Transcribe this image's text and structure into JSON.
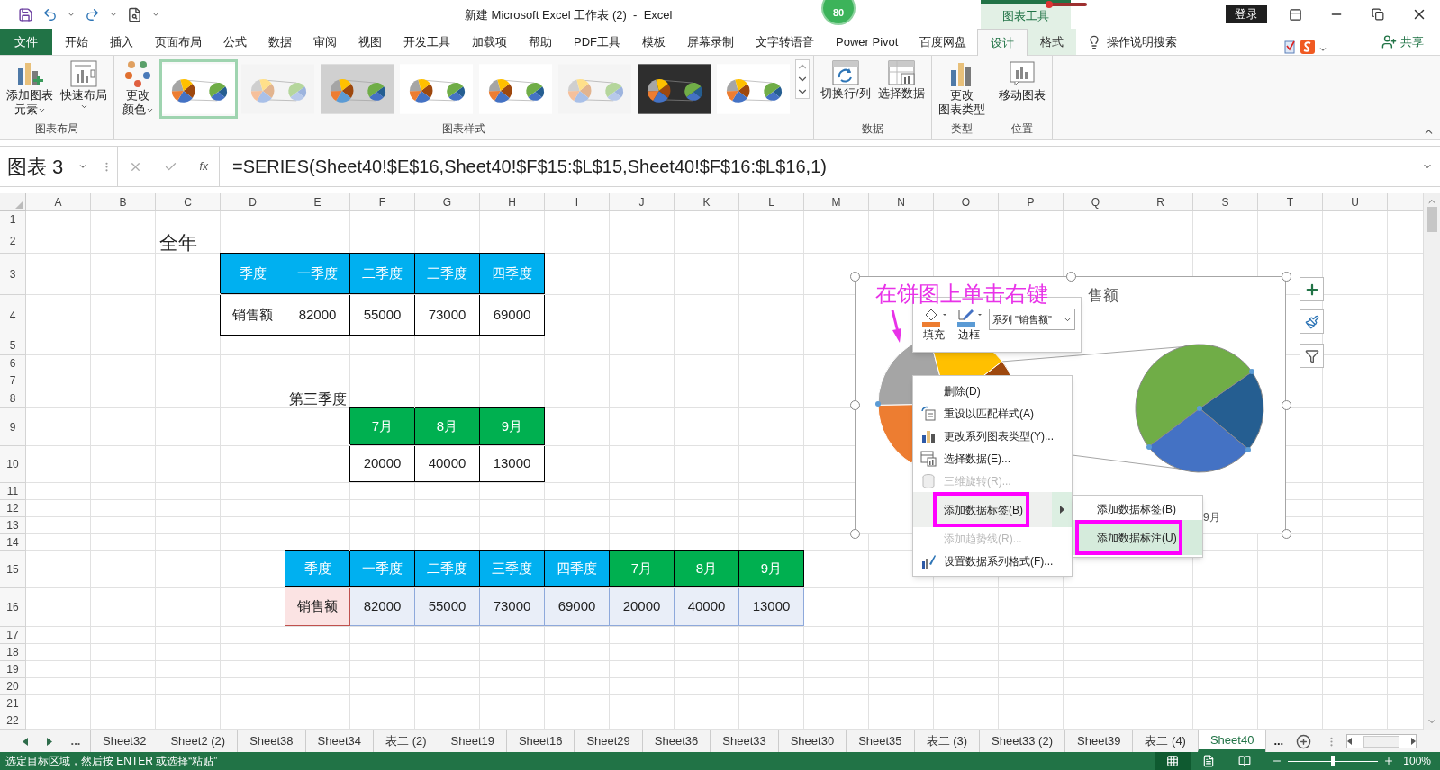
{
  "title_bar": {
    "title": "新建 Microsoft Excel 工作表 (2)  -  Excel",
    "badge": "80",
    "context_group": "图表工具",
    "login": "登录"
  },
  "ribbon_tabs": [
    {
      "label": "文件",
      "kind": "file",
      "selected": false
    },
    {
      "label": "开始",
      "kind": "plain",
      "selected": false
    },
    {
      "label": "插入",
      "kind": "plain",
      "selected": false
    },
    {
      "label": "页面布局",
      "kind": "plain",
      "selected": false
    },
    {
      "label": "公式",
      "kind": "plain",
      "selected": false
    },
    {
      "label": "数据",
      "kind": "plain",
      "selected": false
    },
    {
      "label": "审阅",
      "kind": "plain",
      "selected": false
    },
    {
      "label": "视图",
      "kind": "plain",
      "selected": false
    },
    {
      "label": "开发工具",
      "kind": "plain",
      "selected": false
    },
    {
      "label": "加载项",
      "kind": "plain",
      "selected": false
    },
    {
      "label": "帮助",
      "kind": "plain",
      "selected": false
    },
    {
      "label": "PDF工具",
      "kind": "plain",
      "selected": false
    },
    {
      "label": "模板",
      "kind": "plain",
      "selected": false
    },
    {
      "label": "屏幕录制",
      "kind": "plain",
      "selected": false
    },
    {
      "label": "文字转语音",
      "kind": "plain",
      "selected": false
    },
    {
      "label": "Power Pivot",
      "kind": "plain",
      "selected": false
    },
    {
      "label": "百度网盘",
      "kind": "plain",
      "selected": false
    },
    {
      "label": "设计",
      "kind": "context",
      "selected": true
    },
    {
      "label": "格式",
      "kind": "context",
      "selected": false
    }
  ],
  "tell_me": "操作说明搜索",
  "share": "共享",
  "ribbon_groups": [
    {
      "name": "图表布局",
      "buttons": [
        {
          "lines": [
            "添加图表",
            "元素"
          ],
          "kind": "add-element",
          "dropdown": true
        },
        {
          "lines": [
            "快速布局"
          ],
          "kind": "layout",
          "dropdown": true
        }
      ]
    },
    {
      "name": "图表样式",
      "color_button": {
        "lines": [
          "更改",
          "颜色"
        ],
        "dropdown": true
      },
      "styles": [
        {
          "kind": "light",
          "selected": true
        },
        {
          "kind": "hatched",
          "selected": false
        },
        {
          "kind": "gray",
          "selected": false
        },
        {
          "kind": "light",
          "selected": false
        },
        {
          "kind": "light",
          "selected": false
        },
        {
          "kind": "hatched",
          "selected": false
        },
        {
          "kind": "dark",
          "selected": false
        },
        {
          "kind": "light",
          "selected": false
        }
      ]
    },
    {
      "name": "数据",
      "buttons": [
        {
          "lines": [
            "切换行/列"
          ],
          "kind": "switch",
          "dropdown": false
        },
        {
          "lines": [
            "选择数据"
          ],
          "kind": "select-data",
          "dropdown": false
        }
      ]
    },
    {
      "name": "类型",
      "buttons": [
        {
          "lines": [
            "更改",
            "图表类型"
          ],
          "kind": "change-type",
          "dropdown": false
        }
      ]
    },
    {
      "name": "位置",
      "buttons": [
        {
          "lines": [
            "移动图表"
          ],
          "kind": "move",
          "dropdown": false
        }
      ]
    }
  ],
  "formula_bar": {
    "name_box": "图表 3",
    "function_button": "fx",
    "formula": "=SERIES(Sheet40!$E$16,Sheet40!$F$15:$L$15,Sheet40!$F$16:$L$16,1)"
  },
  "sheet": {
    "columns": [
      "A",
      "B",
      "C",
      "D",
      "E",
      "F",
      "G",
      "H",
      "I",
      "J",
      "K",
      "L",
      "M",
      "N",
      "O",
      "P",
      "Q",
      "R",
      "S",
      "T",
      "U"
    ],
    "rows": [
      "1",
      "2",
      "3",
      "4",
      "5",
      "6",
      "7",
      "8",
      "9",
      "10",
      "11",
      "12",
      "13",
      "14",
      "15",
      "16",
      "17",
      "18",
      "19",
      "20",
      "21",
      "22"
    ],
    "labels": [
      {
        "text": "全年",
        "kind": "heading"
      },
      {
        "text": "第三季度",
        "kind": "label"
      }
    ],
    "tables": [
      {
        "kind": "plain",
        "rows": [
          [
            {
              "text": "季度",
              "color": "#00b0f0"
            },
            {
              "text": "一季度",
              "color": "#00b0f0"
            },
            {
              "text": "二季度",
              "color": "#00b0f0"
            },
            {
              "text": "三季度",
              "color": "#00b0f0"
            },
            {
              "text": "四季度",
              "color": "#00b0f0"
            }
          ],
          [
            {
              "text": "销售额"
            },
            {
              "text": "82000"
            },
            {
              "text": "55000"
            },
            {
              "text": "73000"
            },
            {
              "text": "69000"
            }
          ]
        ]
      },
      {
        "kind": "plain",
        "rows": [
          [
            {
              "text": "7月",
              "color": "#00b050"
            },
            {
              "text": "8月",
              "color": "#00b050"
            },
            {
              "text": "9月",
              "color": "#00b050"
            }
          ],
          [
            {
              "text": "20000"
            },
            {
              "text": "40000"
            },
            {
              "text": "13000"
            }
          ]
        ]
      },
      {
        "kind": "chart-source",
        "rows": [
          [
            {
              "text": "季度",
              "color": "#00b0f0"
            },
            {
              "text": "一季度",
              "color": "#00b0f0"
            },
            {
              "text": "二季度",
              "color": "#00b0f0"
            },
            {
              "text": "三季度",
              "color": "#00b0f0"
            },
            {
              "text": "四季度",
              "color": "#00b0f0"
            },
            {
              "text": "7月",
              "color": "#00b050"
            },
            {
              "text": "8月",
              "color": "#00b050"
            },
            {
              "text": "9月",
              "color": "#00b050"
            }
          ],
          [
            {
              "text": "销售额"
            },
            {
              "text": "82000"
            },
            {
              "text": "55000"
            },
            {
              "text": "73000"
            },
            {
              "text": "69000"
            },
            {
              "text": "20000"
            },
            {
              "text": "40000"
            },
            {
              "text": "13000"
            }
          ]
        ]
      }
    ]
  },
  "chart": {
    "kind": "pie-of-pie",
    "title": "售额",
    "legend_item": "9月",
    "annotation": "在饼图上单击右键"
  },
  "mini_toolbar": {
    "fill": "填充",
    "border": "边框",
    "series": "系列 \"销售额\""
  },
  "context_menu": [
    {
      "label": "删除(D)",
      "kind": "none",
      "submenu": false,
      "disabled": false,
      "selected": false,
      "annotated": false
    },
    {
      "label": "重设以匹配样式(A)",
      "kind": "reset",
      "submenu": false,
      "disabled": false,
      "selected": false,
      "annotated": false
    },
    {
      "label": "更改系列图表类型(Y)...",
      "kind": "chart",
      "submenu": false,
      "disabled": false,
      "selected": false,
      "annotated": false
    },
    {
      "label": "选择数据(E)...",
      "kind": "table",
      "submenu": false,
      "disabled": false,
      "selected": false,
      "annotated": false
    },
    {
      "label": "三维旋转(R)...",
      "kind": "cube",
      "submenu": false,
      "disabled": true,
      "selected": false,
      "annotated": false
    },
    {
      "label": "添加数据标签(B)",
      "kind": "none",
      "submenu": true,
      "disabled": false,
      "selected": true,
      "annotated": true
    },
    {
      "label": "添加趋势线(R)...",
      "kind": "none",
      "submenu": false,
      "disabled": true,
      "selected": false,
      "annotated": false
    },
    {
      "label": "设置数据系列格式(F)...",
      "kind": "format",
      "submenu": false,
      "disabled": false,
      "selected": false,
      "annotated": false
    }
  ],
  "submenu": [
    {
      "label": "添加数据标签(B)",
      "selected": false,
      "annotated": false
    },
    {
      "label": "添加数据标注(U)",
      "selected": true,
      "annotated": true
    }
  ],
  "sheet_tabs": [
    {
      "label": "Sheet32",
      "selected": false
    },
    {
      "label": "Sheet2 (2)",
      "selected": false
    },
    {
      "label": "Sheet38",
      "selected": false
    },
    {
      "label": "Sheet34",
      "selected": false
    },
    {
      "label": "表二 (2)",
      "selected": false
    },
    {
      "label": "Sheet19",
      "selected": false
    },
    {
      "label": "Sheet16",
      "selected": false
    },
    {
      "label": "Sheet29",
      "selected": false
    },
    {
      "label": "Sheet36",
      "selected": false
    },
    {
      "label": "Sheet33",
      "selected": false
    },
    {
      "label": "Sheet30",
      "selected": false
    },
    {
      "label": "Sheet35",
      "selected": false
    },
    {
      "label": "表二 (3)",
      "selected": false
    },
    {
      "label": "Sheet33 (2)",
      "selected": false
    },
    {
      "label": "Sheet39",
      "selected": false
    },
    {
      "label": "表二 (4)",
      "selected": false
    },
    {
      "label": "Sheet40",
      "selected": true
    }
  ],
  "tab_overflow": "...",
  "tab_overflow_right": "...",
  "status_bar": {
    "message": "选定目标区域，然后按 ENTER 或选择“粘贴”",
    "zoom": {
      "level": 0.5,
      "reading": "100%"
    }
  }
}
